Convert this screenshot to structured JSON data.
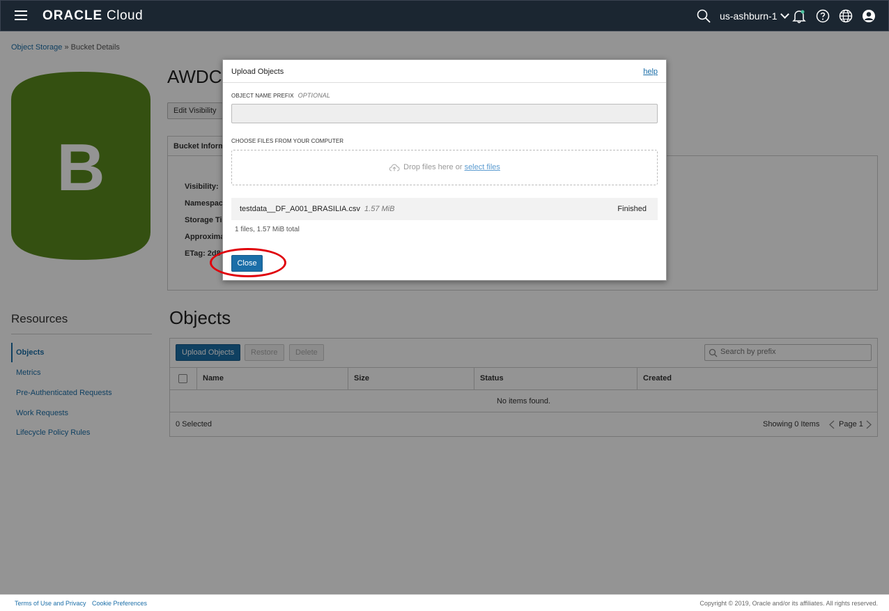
{
  "topbar": {
    "brand_oracle": "ORACLE",
    "brand_cloud": "Cloud",
    "region": "us-ashburn-1"
  },
  "breadcrumb": {
    "parent": "Object Storage",
    "separator": "»",
    "current": "Bucket Details"
  },
  "bucket": {
    "badge_letter": "B",
    "badge_color": "#5a8a1e",
    "title": "AWDC",
    "edit_visibility_label": "Edit Visibility",
    "info_tab_label": "Bucket Information",
    "info_labels": [
      "Visibility:",
      "Namespace:",
      "Storage Tier:",
      "Approximate",
      "ETag: 2d8"
    ]
  },
  "resources": {
    "title": "Resources",
    "items": [
      "Objects",
      "Metrics",
      "Pre-Authenticated Requests",
      "Work Requests",
      "Lifecycle Policy Rules"
    ]
  },
  "objects": {
    "title": "Objects",
    "upload_label": "Upload Objects",
    "restore_label": "Restore",
    "delete_label": "Delete",
    "search_placeholder": "Search by prefix",
    "columns": [
      "Name",
      "Size",
      "Status",
      "Created"
    ],
    "empty_message": "No items found.",
    "selected_text": "0 Selected",
    "showing_text": "Showing 0 Items",
    "page_text": "Page 1"
  },
  "dialog": {
    "title": "Upload Objects",
    "help_label": "help",
    "prefix_label": "OBJECT NAME PREFIX",
    "prefix_optional": "OPTIONAL",
    "prefix_value": "",
    "choose_label": "CHOOSE FILES FROM YOUR COMPUTER",
    "drop_text": "Drop files here or",
    "select_files_label": "select files",
    "file": {
      "name": "testdata__DF_A001_BRASILIA.csv",
      "size": "1.57 MiB",
      "status": "Finished"
    },
    "files_total": "1 files, 1.57 MiB total",
    "close_label": "Close"
  },
  "footer": {
    "terms": "Terms of Use and Privacy",
    "cookies": "Cookie Preferences",
    "copyright": "Copyright © 2019, Oracle and/or its affiliates. All rights reserved."
  },
  "colors": {
    "topbar": "#1b2631",
    "primary": "#1b6ea8",
    "highlight": "#e0000a"
  }
}
